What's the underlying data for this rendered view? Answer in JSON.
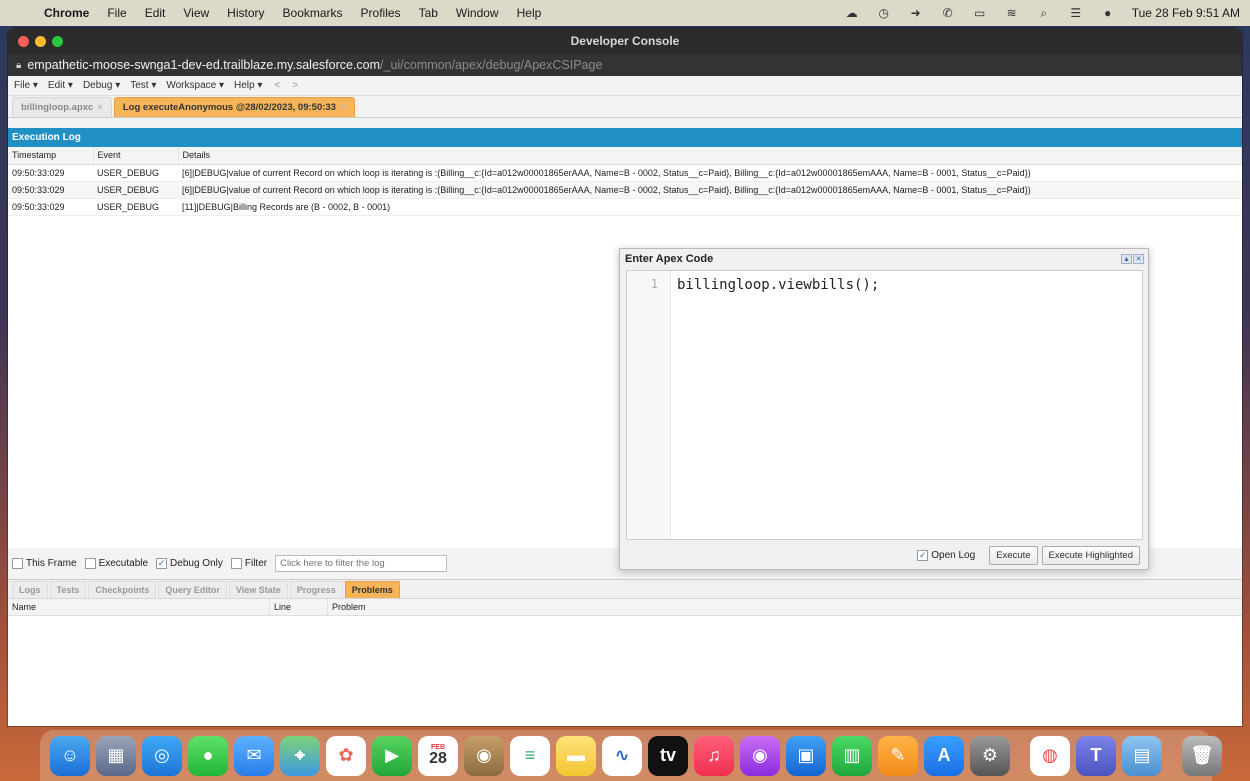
{
  "menubar": {
    "app": "Chrome",
    "items": [
      "File",
      "Edit",
      "View",
      "History",
      "Bookmarks",
      "Profiles",
      "Tab",
      "Window",
      "Help"
    ],
    "clock": "Tue 28 Feb  9:51 AM"
  },
  "window": {
    "title": "Developer Console",
    "url_host": "empathetic-moose-swnga1-dev-ed.trailblaze.my.salesforce.com",
    "url_path": "/_ui/common/apex/debug/ApexCSIPage"
  },
  "dc_menu": [
    "File ▾",
    "Edit ▾",
    "Debug ▾",
    "Test ▾",
    "Workspace ▾",
    "Help ▾",
    "<",
    ">"
  ],
  "file_tabs": [
    {
      "label": "billingloop.apxc",
      "active": false
    },
    {
      "label": "Log executeAnonymous @28/02/2023, 09:50:33",
      "active": true
    }
  ],
  "execution_log": {
    "title": "Execution Log",
    "columns": [
      "Timestamp",
      "Event",
      "Details"
    ],
    "rows": [
      [
        "09:50:33:029",
        "USER_DEBUG",
        "[6]|DEBUG|value of current Record on which loop is iterating is :(Billing__c:{Id=a012w00001865erAAA, Name=B - 0002, Status__c=Paid}, Billing__c:{Id=a012w00001865emAAA, Name=B - 0001, Status__c=Paid})"
      ],
      [
        "09:50:33:029",
        "USER_DEBUG",
        "[6]|DEBUG|value of current Record on which loop is iterating is :(Billing__c:{Id=a012w00001865erAAA, Name=B - 0002, Status__c=Paid}, Billing__c:{Id=a012w00001865emAAA, Name=B - 0001, Status__c=Paid})"
      ],
      [
        "09:50:33:029",
        "USER_DEBUG",
        "[11]|DEBUG|Billing Records are (B - 0002, B - 0001)"
      ]
    ]
  },
  "filter": {
    "this_frame": "This Frame",
    "executable": "Executable",
    "debug_only": "Debug Only",
    "filter": "Filter",
    "placeholder": "Click here to filter the log"
  },
  "bottom_tabs": [
    {
      "label": "Logs",
      "active": false
    },
    {
      "label": "Tests",
      "active": false
    },
    {
      "label": "Checkpoints",
      "active": false
    },
    {
      "label": "Query Editor",
      "active": false
    },
    {
      "label": "View State",
      "active": false
    },
    {
      "label": "Progress",
      "active": false
    },
    {
      "label": "Problems",
      "active": true
    }
  ],
  "problems": {
    "columns": [
      "Name",
      "Line",
      "Problem"
    ]
  },
  "apex_dialog": {
    "title": "Enter Apex Code",
    "line_number": "1",
    "code": "billingloop.viewbills();",
    "open_log": "Open Log",
    "execute": "Execute",
    "execute_highlighted": "Execute Highlighted"
  },
  "dock": {
    "calendar_month": "FEB",
    "calendar_day": "28",
    "apps": [
      "finder-icon",
      "launchpad-icon",
      "safari-icon",
      "messages-icon",
      "mail-icon",
      "maps-icon",
      "photos-icon",
      "facetime-icon",
      "calendar-icon",
      "contacts-icon",
      "reminders-icon",
      "notes-icon",
      "freeform-icon",
      "tv-icon",
      "music-icon",
      "podcasts-icon",
      "keynote-icon",
      "numbers-icon",
      "pages-icon",
      "appstore-icon",
      "settings-icon",
      "chrome-icon",
      "teams-icon",
      "preview-icon",
      "trash-icon"
    ]
  }
}
